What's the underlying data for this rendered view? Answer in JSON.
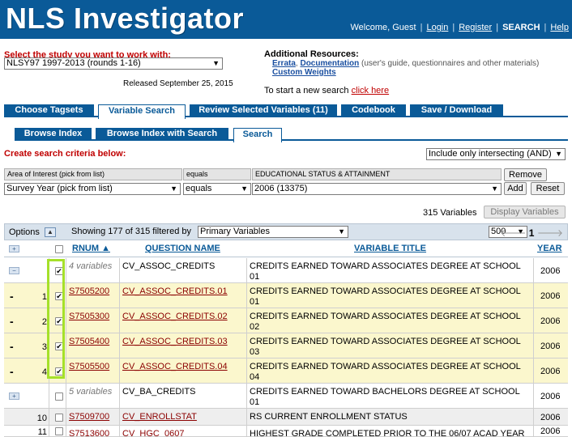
{
  "header": {
    "app_title": "NLS Investigator",
    "welcome": "Welcome, Guest",
    "login": "Login",
    "register": "Register",
    "search": "SEARCH",
    "help": "Help"
  },
  "study": {
    "label": "Select the study you want to work with:",
    "selected": "NLSY97 1997-2013 (rounds 1-16)",
    "released": "Released September 25, 2015"
  },
  "resources": {
    "title": "Additional Resources:",
    "errata": "Errata",
    "documentation": "Documentation",
    "doc_note": "(user's guide, questionnaires and other materials)",
    "custom_weights": "Custom Weights",
    "new_search_text": "To start a new search",
    "new_search_link": "click here"
  },
  "main_tabs": [
    "Choose Tagsets",
    "Variable Search",
    "Review Selected Variables (11)",
    "Codebook",
    "Save / Download"
  ],
  "sub_tabs": [
    "Browse Index",
    "Browse Index with Search",
    "Search"
  ],
  "criteria": {
    "label": "Create search criteria below:",
    "mode": "Include only intersecting (AND)",
    "head_area": "Area of Interest  (pick from list)",
    "head_op": "equals",
    "head_value": "EDUCATIONAL STATUS & ATTAINMENT",
    "area": "Survey Year  (pick from list)",
    "op": "equals",
    "value": "2006 (13375)",
    "remove": "Remove",
    "add": "Add",
    "reset": "Reset"
  },
  "results": {
    "total": "315 Variables",
    "display_button": "Display Variables",
    "options": "Options",
    "showing": "Showing 177 of 315  filtered by",
    "filter": "Primary Variables",
    "per_page": "500",
    "page": "1",
    "columns": [
      "RNUM",
      "QUESTION NAME",
      "VARIABLE TITLE",
      "YEAR"
    ],
    "rows": [
      {
        "kind": "group",
        "style": "white",
        "expanded": true,
        "checked": true,
        "num": "",
        "rnum": "4 variables",
        "qname": "CV_ASSOC_CREDITS",
        "title1": "CREDITS EARNED TOWARD ASSOCIATES DEGREE AT SCHOOL",
        "title2": "01",
        "year": "2006"
      },
      {
        "kind": "item",
        "style": "yellow",
        "checked": true,
        "num": "1",
        "rnum": "S7505200",
        "qname": "CV_ASSOC_CREDITS.01",
        "title1": "CREDITS EARNED TOWARD ASSOCIATES DEGREE AT SCHOOL",
        "title2": "01",
        "year": "2006"
      },
      {
        "kind": "item",
        "style": "yellow",
        "checked": true,
        "num": "2",
        "rnum": "S7505300",
        "qname": "CV_ASSOC_CREDITS.02",
        "title1": "CREDITS EARNED TOWARD ASSOCIATES DEGREE AT SCHOOL",
        "title2": "02",
        "year": "2006"
      },
      {
        "kind": "item",
        "style": "yellow",
        "checked": true,
        "num": "3",
        "rnum": "S7505400",
        "qname": "CV_ASSOC_CREDITS.03",
        "title1": "CREDITS EARNED TOWARD ASSOCIATES DEGREE AT SCHOOL",
        "title2": "03",
        "year": "2006"
      },
      {
        "kind": "item",
        "style": "yellow",
        "checked": true,
        "num": "4",
        "rnum": "S7505500",
        "qname": "CV_ASSOC_CREDITS.04",
        "title1": "CREDITS EARNED TOWARD ASSOCIATES DEGREE AT SCHOOL",
        "title2": "04",
        "year": "2006"
      },
      {
        "kind": "group",
        "style": "white",
        "expanded": false,
        "checked": false,
        "num": "",
        "rnum": "5 variables",
        "qname": "CV_BA_CREDITS",
        "title1": "CREDITS EARNED TOWARD BACHELORS DEGREE AT SCHOOL",
        "title2": "01",
        "year": "2006"
      },
      {
        "kind": "item",
        "style": "gray",
        "checked": false,
        "num": "10",
        "rnum": "S7509700",
        "qname": "CV_ENROLLSTAT",
        "title1": "RS CURRENT ENROLLMENT STATUS",
        "title2": "",
        "year": "2006"
      },
      {
        "kind": "item",
        "style": "white",
        "checked": false,
        "num": "11",
        "rnum": "S7513600",
        "qname": "CV_HGC_0607",
        "title1": "HIGHEST GRADE COMPLETED PRIOR TO THE 06/07 ACAD YEAR",
        "title2": "",
        "year": "2006"
      }
    ]
  }
}
